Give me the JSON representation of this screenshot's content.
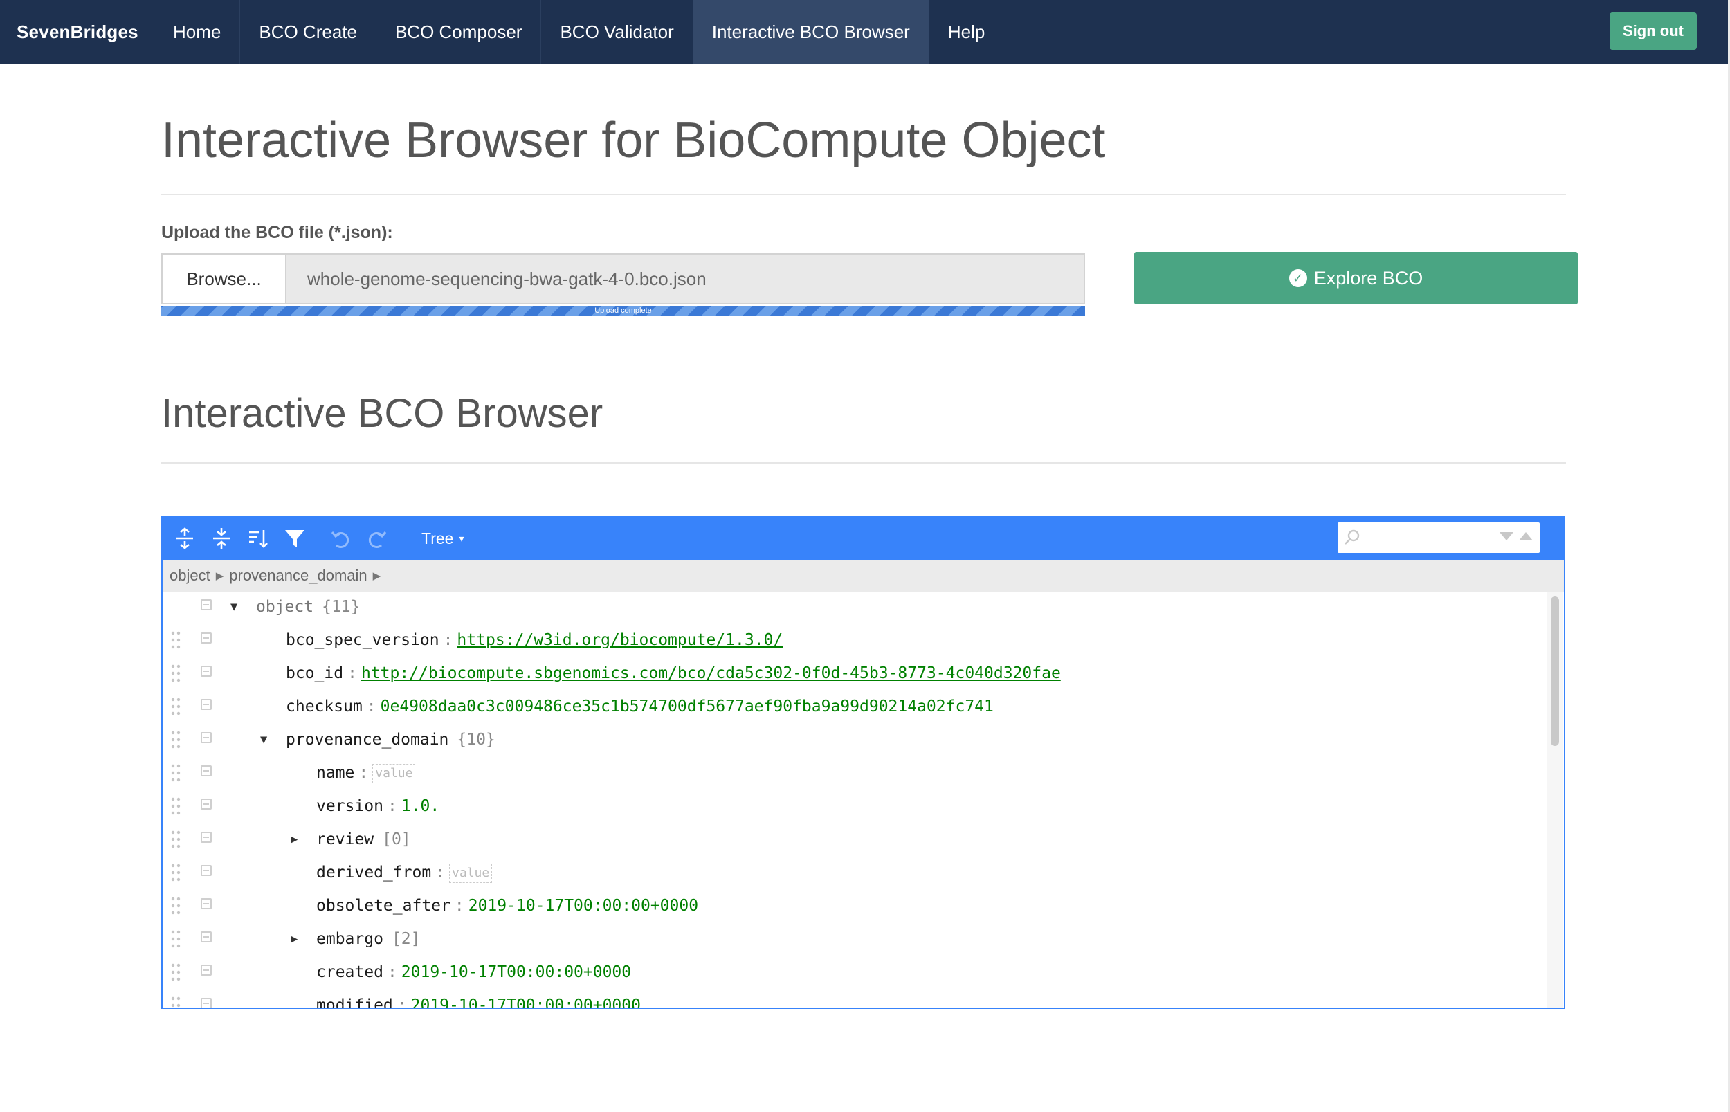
{
  "navbar": {
    "brand": "SevenBridges",
    "items": [
      {
        "label": "Home"
      },
      {
        "label": "BCO Create"
      },
      {
        "label": "BCO Composer"
      },
      {
        "label": "BCO Validator"
      },
      {
        "label": "Interactive BCO Browser",
        "active": true
      },
      {
        "label": "Help"
      }
    ],
    "sign_out": "Sign out",
    "background": "#1e3150",
    "accent": "#4aa583"
  },
  "page": {
    "title": "Interactive Browser for BioCompute Object"
  },
  "upload": {
    "label": "Upload the BCO file (*.json):",
    "browse": "Browse...",
    "filename": "whole-genome-sequencing-bwa-gatk-4-0.bco.json",
    "progress_text": "Upload complete",
    "progress": 1.0
  },
  "explore": {
    "label": "Explore BCO",
    "icon": "check-circle-icon"
  },
  "browser": {
    "title": "Interactive BCO Browser",
    "toolbar": {
      "icons": [
        "expand-all-icon",
        "collapse-all-icon",
        "sort-icon",
        "filter-icon",
        "undo-icon",
        "redo-icon"
      ],
      "mode": "Tree",
      "search_icon": "search-icon"
    },
    "breadcrumb": [
      "object",
      "provenance_domain"
    ],
    "rows": [
      {
        "key": "object",
        "count": "{11}",
        "type": "object",
        "expanded": true
      },
      {
        "key": "bco_spec_version",
        "value": "https://w3id.org/biocompute/1.3.0/",
        "type": "link"
      },
      {
        "key": "bco_id",
        "value": "http://biocompute.sbgenomics.com/bco/cda5c302-0f0d-45b3-8773-4c040d320fae",
        "type": "link"
      },
      {
        "key": "checksum",
        "value": "0e4908daa0c3c009486ce35c1b574700df5677aef90fba9a99d90214a02fc741",
        "type": "string"
      },
      {
        "key": "provenance_domain",
        "count": "{10}",
        "type": "object",
        "expanded": true
      },
      {
        "key": "name",
        "placeholder": "value",
        "type": "empty"
      },
      {
        "key": "version",
        "value": "1.0.",
        "type": "string"
      },
      {
        "key": "review",
        "count": "[0]",
        "type": "array",
        "expanded": false
      },
      {
        "key": "derived_from",
        "placeholder": "value",
        "type": "empty"
      },
      {
        "key": "obsolete_after",
        "value": "2019-10-17T00:00:00+0000",
        "type": "string"
      },
      {
        "key": "embargo",
        "count": "[2]",
        "type": "array",
        "expanded": false
      },
      {
        "key": "created",
        "value": "2019-10-17T00:00:00+0000",
        "type": "string"
      },
      {
        "key": "modified",
        "value": "2019-10-17T00:00:00+0000",
        "type": "string"
      }
    ]
  }
}
